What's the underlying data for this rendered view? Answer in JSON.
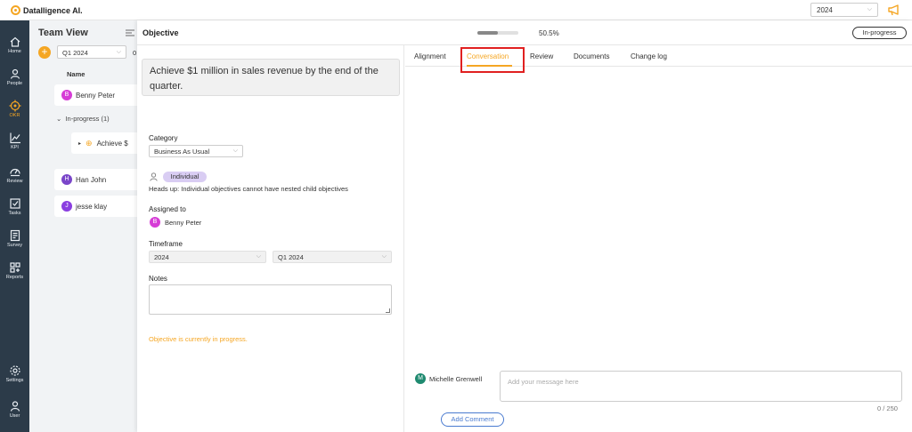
{
  "app": {
    "brand": "Datalligence AI.",
    "year_select": "2024"
  },
  "sidebar": {
    "items": [
      {
        "label": "Home",
        "icon": "home-icon"
      },
      {
        "label": "People",
        "icon": "people-icon"
      },
      {
        "label": "OKR",
        "icon": "okr-icon",
        "active": true
      },
      {
        "label": "KPI",
        "icon": "kpi-icon"
      },
      {
        "label": "Review",
        "icon": "review-icon"
      },
      {
        "label": "Tasks",
        "icon": "tasks-icon"
      },
      {
        "label": "Survey",
        "icon": "survey-icon"
      },
      {
        "label": "Reports",
        "icon": "reports-icon"
      },
      {
        "label": "Settings",
        "icon": "settings-icon"
      },
      {
        "label": "User",
        "icon": "user-icon"
      }
    ]
  },
  "team_view": {
    "title": "Team View",
    "quarter": "Q1 2024",
    "cut_text": "0",
    "column_header": "Name",
    "members": [
      {
        "initial": "B",
        "name": "Benny Peter",
        "color": "#d63cd6"
      },
      {
        "initial": "H",
        "name": "Han John",
        "color": "#7a46c9"
      },
      {
        "initial": "J",
        "name": "jesse klay",
        "color": "#8a3ee0"
      }
    ],
    "group_label": "In-progress (1)",
    "objective_item": "Achieve $"
  },
  "objective": {
    "header": "Objective",
    "progress_percent": 50.5,
    "progress_text": "50.5%",
    "status": "In-progress",
    "title": "Achieve $1 million in sales revenue by the end of the quarter.",
    "category_label": "Category",
    "category_value": "Business As Usual",
    "type": "Individual",
    "headsup": "Heads up: Individual objectives cannot have nested child objectives",
    "assigned_label": "Assigned to",
    "assignee": {
      "initial": "B",
      "name": "Benny Peter"
    },
    "timeframe_label": "Timeframe",
    "timeframe_year": "2024",
    "timeframe_quarter": "Q1 2024",
    "notes_label": "Notes",
    "notes_value": "",
    "status_note": "Objective is currently in progress."
  },
  "tabs": [
    "Alignment",
    "Conversation",
    "Review",
    "Documents",
    "Change log"
  ],
  "active_tab": "Conversation",
  "conversation": {
    "commenter_initial": "M",
    "commenter": "Michelle Grenwell",
    "placeholder": "Add your message here",
    "char_count": "0 / 250",
    "add_button": "Add Comment"
  },
  "colors": {
    "accent": "#f5a623",
    "sidebar": "#2c3b49",
    "highlight": "#e02020",
    "link": "#4a7bd0"
  }
}
